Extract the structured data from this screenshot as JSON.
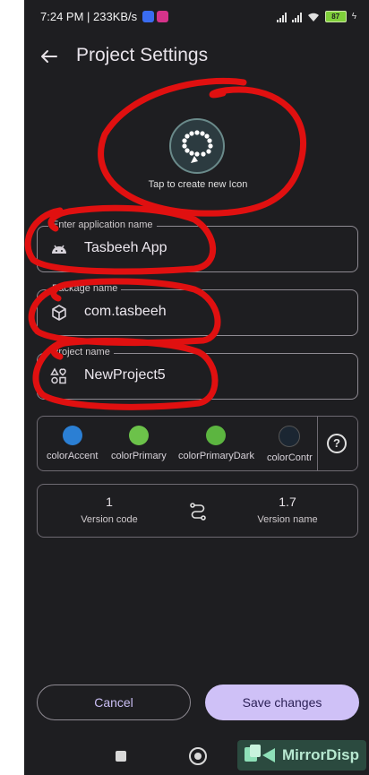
{
  "status": {
    "time_speed": "7:24 PM | 233KB/s",
    "battery": "87"
  },
  "appbar": {
    "title": "Project Settings"
  },
  "icon_picker": {
    "caption": "Tap to create new Icon"
  },
  "fields": [
    {
      "label": "Enter application name",
      "value": "Tasbeeh App",
      "icon": "android-icon"
    },
    {
      "label": "Package name",
      "value": "com.tasbeeh",
      "icon": "package-icon"
    },
    {
      "label": "Project name",
      "value": "NewProject5",
      "icon": "shapes-icon"
    }
  ],
  "colors": [
    {
      "name": "colorAccent",
      "hex": "#2b7fd4"
    },
    {
      "name": "colorPrimary",
      "hex": "#6cc24a"
    },
    {
      "name": "colorPrimaryDark",
      "hex": "#5cb540"
    },
    {
      "name": "colorContr",
      "hex": "#1b2632"
    }
  ],
  "help_glyph": "?",
  "version": {
    "code_value": "1",
    "code_label": "Version code",
    "name_value": "1.7",
    "name_label": "Version name"
  },
  "buttons": {
    "cancel": "Cancel",
    "save": "Save changes"
  },
  "watermark": {
    "text": "MirrorDisp"
  }
}
